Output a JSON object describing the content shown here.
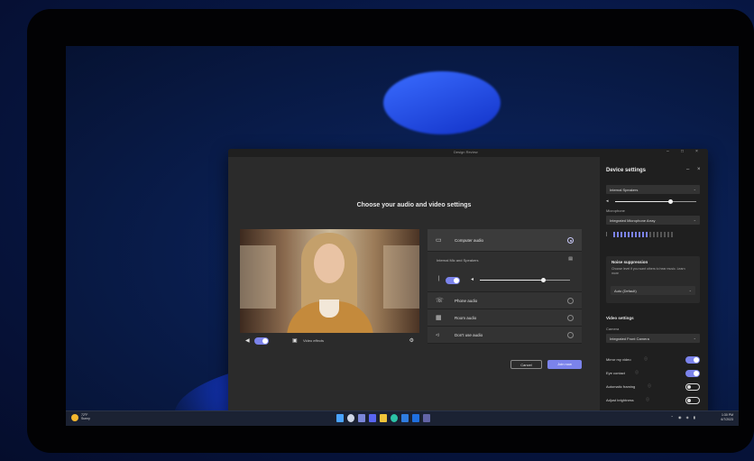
{
  "window": {
    "title": "Design Review",
    "controls": [
      "–",
      "□",
      "×"
    ]
  },
  "main": {
    "heading": "Choose your audio and video settings",
    "camera_controls": {
      "video_effects_label": "Video effects"
    },
    "audio_options": [
      {
        "label": "Computer audio",
        "icon": "monitor-icon",
        "selected": true
      },
      {
        "label": "Phone audio",
        "icon": "phone-icon",
        "selected": false
      },
      {
        "label": "Room audio",
        "icon": "room-icon",
        "selected": false
      },
      {
        "label": "Don't use audio",
        "icon": "speaker-off-icon",
        "selected": false
      }
    ],
    "computer_audio_device": "Internal Mic and Speakers",
    "volume_level": 0.7,
    "buttons": {
      "cancel": "Cancel",
      "join": "Join now"
    }
  },
  "device_settings": {
    "title": "Device settings",
    "speaker_dropdown": "Internal Speakers",
    "speaker_volume": 0.68,
    "microphone_label": "Microphone",
    "microphone_dropdown": "Integrated Microphone Array",
    "mic_level_active_bars": 10,
    "mic_level_total_bars": 17,
    "noise_suppression": {
      "title": "Noise suppression",
      "description": "Choose level if you want others to hear music. Learn more",
      "value": "Auto (Default)"
    },
    "video_settings_title": "Video settings",
    "camera_label": "Camera",
    "camera_dropdown": "Integrated Front Camera",
    "toggles": [
      {
        "label": "Mirror my video",
        "on": true
      },
      {
        "label": "Eye contact",
        "on": true
      },
      {
        "label": "Automatic framing",
        "on": false
      },
      {
        "label": "Adjust brightness",
        "on": false
      },
      {
        "label": "Soft focus",
        "on": true
      }
    ]
  },
  "taskbar": {
    "weather_temp": "72°F",
    "weather_desc": "Sunny",
    "time": "1:30 PM",
    "date": "6/7/2023"
  },
  "colors": {
    "accent": "#7b83eb",
    "window_bg": "#2b2b2b",
    "panel_bg": "#1f1f1f"
  }
}
